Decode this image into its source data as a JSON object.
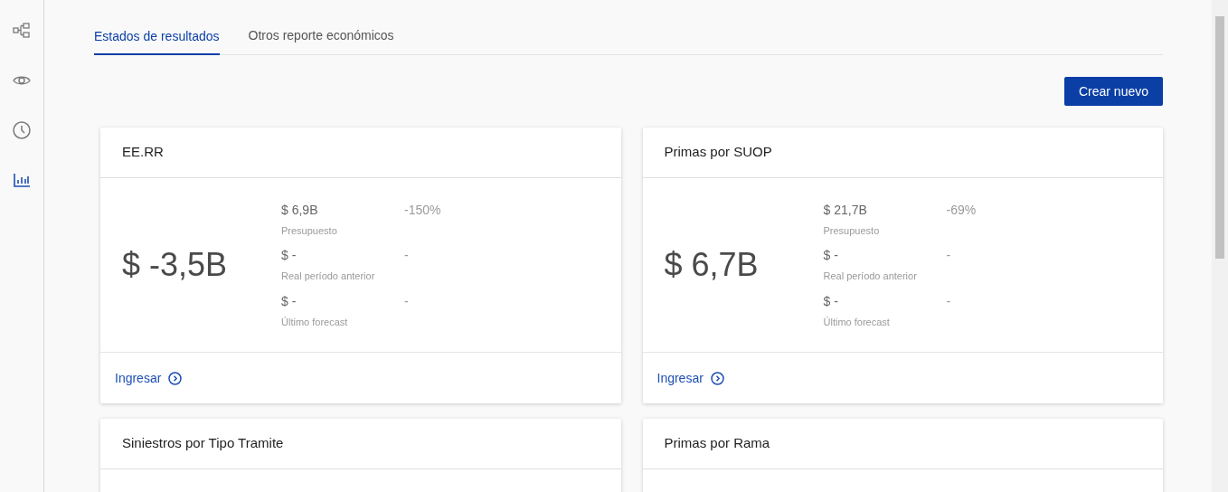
{
  "sidebar": {
    "items": [
      {
        "kind": "hierarchy",
        "selected": false
      },
      {
        "kind": "eye",
        "selected": false
      },
      {
        "kind": "clock",
        "selected": false
      },
      {
        "kind": "chart",
        "selected": true
      }
    ]
  },
  "tabs": [
    {
      "label": "Estados de resultados",
      "selected": true
    },
    {
      "label": "Otros reporte económicos",
      "selected": false
    }
  ],
  "create_button": "Crear nuevo",
  "cards": [
    {
      "title": "EE.RR",
      "value": "$ -3,5B",
      "metrics": [
        {
          "amount": "$ 6,9B",
          "label": "Presupuesto",
          "variation": "-150%"
        },
        {
          "amount": "$ -",
          "label": "Real período anterior",
          "variation": "-"
        },
        {
          "amount": "$ -",
          "label": "Último forecast",
          "variation": "-"
        }
      ],
      "link": "Ingresar"
    },
    {
      "title": "Primas por SUOP",
      "value": "$ 6,7B",
      "metrics": [
        {
          "amount": "$ 21,7B",
          "label": "Presupuesto",
          "variation": "-69%"
        },
        {
          "amount": "$ -",
          "label": "Real período anterior",
          "variation": "-"
        },
        {
          "amount": "$ -",
          "label": "Último forecast",
          "variation": "-"
        }
      ],
      "link": "Ingresar"
    },
    {
      "title": "Siniestros por Tipo Tramite"
    },
    {
      "title": "Primas por Rama"
    }
  ]
}
